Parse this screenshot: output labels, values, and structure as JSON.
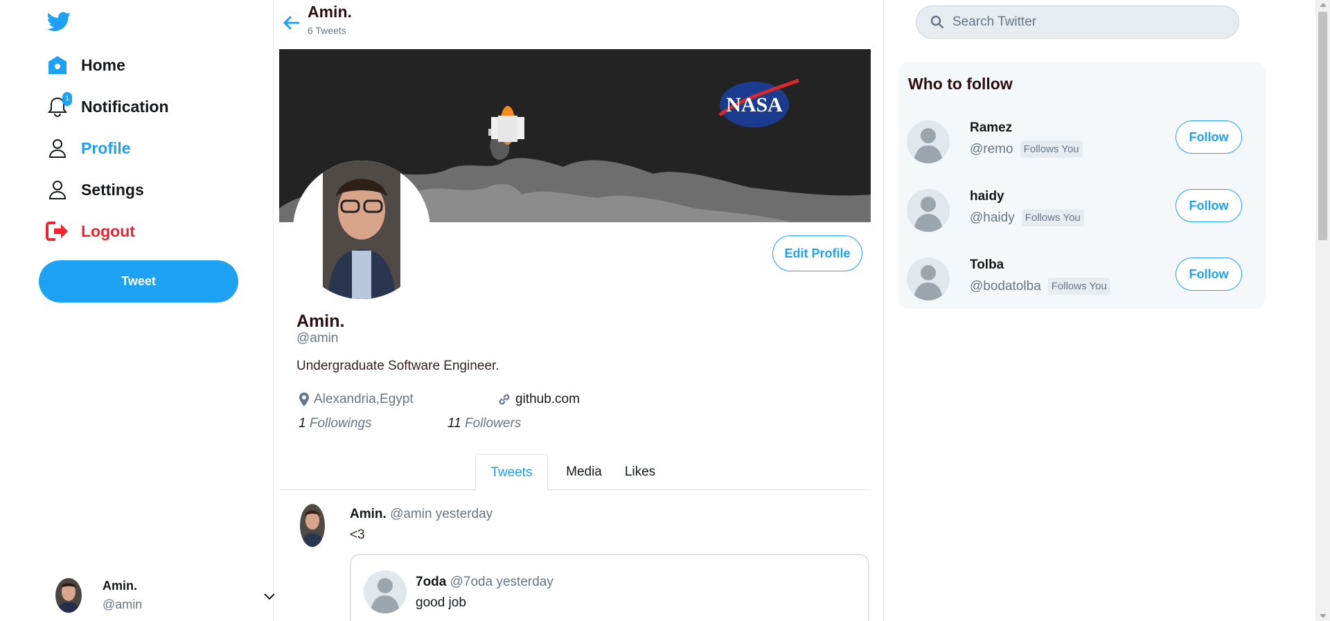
{
  "sidebar": {
    "logo_icon": "twitter-bird-icon",
    "nav": {
      "home": {
        "label": "Home",
        "icon": "home-icon"
      },
      "notification": {
        "label": "Notification",
        "icon": "bell-icon",
        "badge": "1"
      },
      "profile": {
        "label": "Profile",
        "icon": "user-icon"
      },
      "settings": {
        "label": "Settings",
        "icon": "user-icon"
      },
      "logout": {
        "label": "Logout",
        "icon": "logout-icon"
      }
    },
    "tweet_button": "Tweet",
    "account": {
      "name": "Amin.",
      "handle": "@amin",
      "menu_icon": "chevron-down-icon"
    }
  },
  "header": {
    "title": "Amin.",
    "subtitle": "6 Tweets",
    "back_icon": "arrow-left-icon"
  },
  "profile": {
    "banner_logo_text": "NASA",
    "name": "Amin.",
    "handle": "@amin",
    "bio": "Undergraduate Software Engineer.",
    "location": "Alexandria,Egypt",
    "website": "github.com",
    "followings_count": "1",
    "followings_label": "Followings",
    "followers_count": "11",
    "followers_label": "Followers",
    "edit_button": "Edit Profile"
  },
  "tabs": [
    {
      "label": "Tweets",
      "active": true
    },
    {
      "label": "Media",
      "active": false
    },
    {
      "label": "Likes",
      "active": false
    }
  ],
  "timeline": [
    {
      "name": "Amin.",
      "meta": "@amin yesterday",
      "text": "<3",
      "quote": {
        "name": "7oda",
        "meta": "@7oda yesterday",
        "text": "good job"
      }
    }
  ],
  "search": {
    "placeholder": "Search Twitter"
  },
  "who_to_follow": {
    "title": "Who to follow",
    "follows_you_label": "Follows You",
    "follow_label": "Follow",
    "users": [
      {
        "name": "Ramez",
        "handle": "@remo"
      },
      {
        "name": "haidy",
        "handle": "@haidy"
      },
      {
        "name": "Tolba",
        "handle": "@bodatolba"
      }
    ]
  },
  "colors": {
    "accent": "#1da1f2",
    "logout": "#f4212e",
    "panel": "#f5f8fa",
    "banner": "#232323"
  }
}
